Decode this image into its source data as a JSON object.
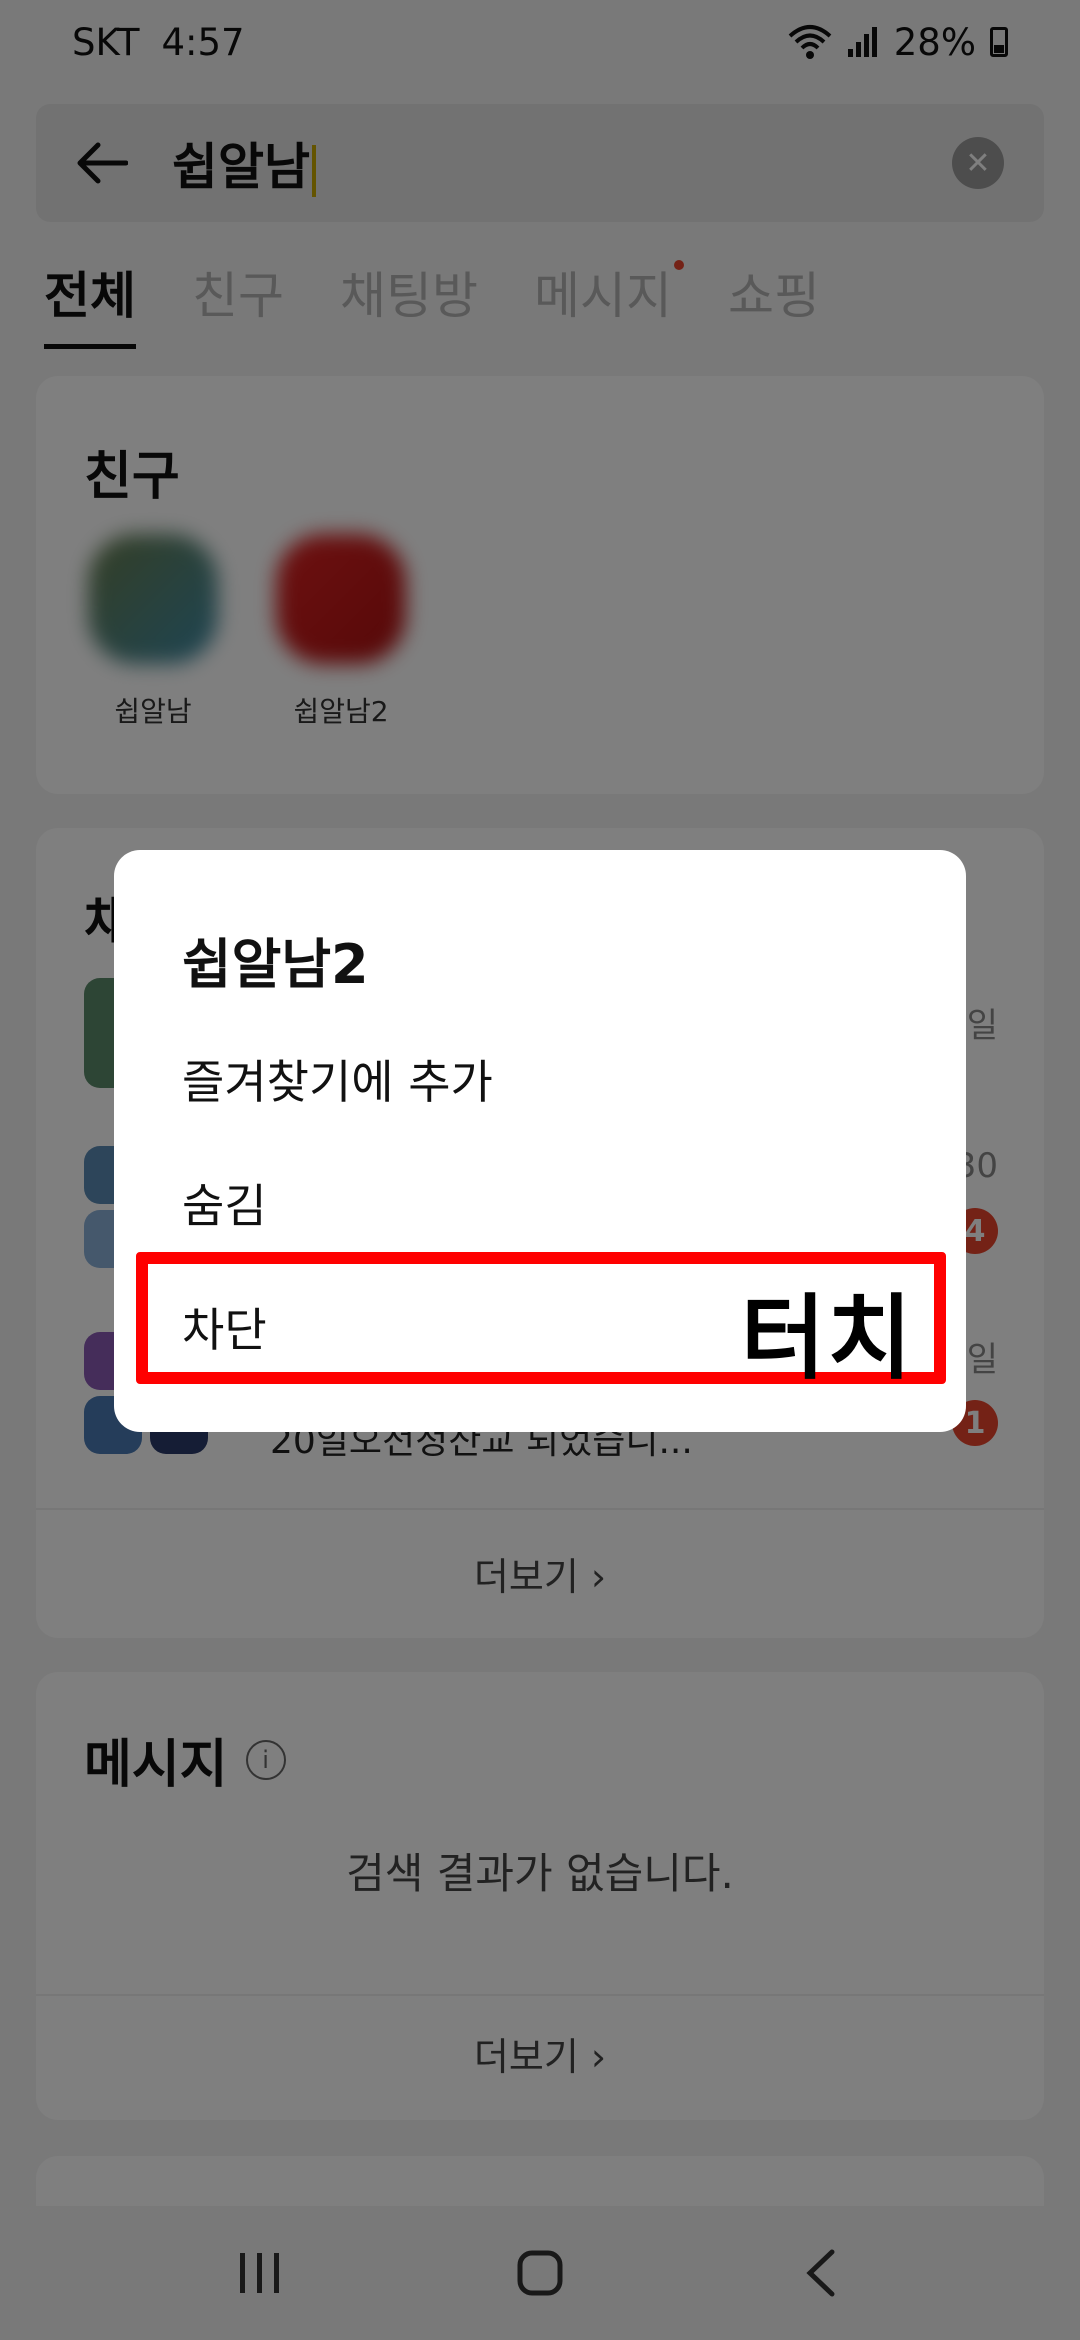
{
  "status_bar": {
    "carrier": "SKT",
    "time": "4:57",
    "battery": "28%"
  },
  "search": {
    "query": "쉽알남"
  },
  "tabs": [
    {
      "label": "전체",
      "active": true
    },
    {
      "label": "친구",
      "active": false
    },
    {
      "label": "채팅방",
      "active": false
    },
    {
      "label": "메시지",
      "active": false,
      "has_dot": true
    },
    {
      "label": "쇼핑",
      "active": false
    }
  ],
  "friends": {
    "title": "친구",
    "items": [
      {
        "name": "쉽알남"
      },
      {
        "name": "쉽알남2"
      }
    ]
  },
  "chats": {
    "title_partial": "채",
    "rows": [
      {
        "preview": "",
        "time": "일",
        "badge": ""
      },
      {
        "preview": "",
        "time": "30",
        "badge": "4"
      },
      {
        "preview": "20일오전정산교 되었습니...",
        "time": "일",
        "badge": "1"
      }
    ],
    "more_label": "더보기 ›"
  },
  "messages": {
    "title": "메시지",
    "info_icon_glyph": "i",
    "empty_text": "검색 결과가 없습니다.",
    "more_label": "더보기 ›"
  },
  "dialog": {
    "title": "쉽알남2",
    "items": [
      {
        "label": "즐겨찾기에 추가"
      },
      {
        "label": "숨김"
      },
      {
        "label": "차단"
      }
    ],
    "annotation": "터치"
  },
  "colors": {
    "accent": "#e8452d",
    "highlight": "#ff0000",
    "caret": "#c9a800"
  }
}
